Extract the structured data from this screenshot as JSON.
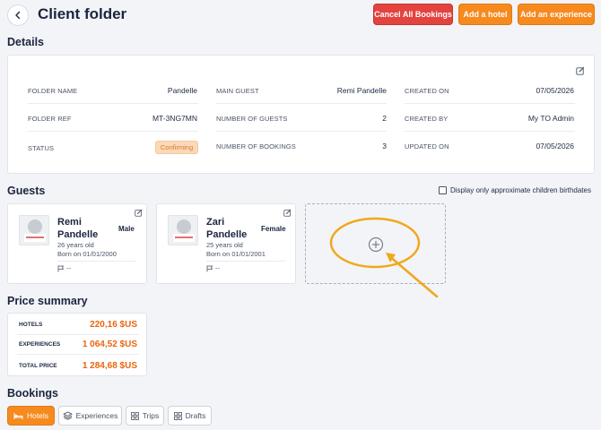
{
  "header": {
    "title": "Client folder",
    "cancel_all_bookings": "Cancel All Bookings",
    "add_hotel": "Add a hotel",
    "add_experience": "Add an experience"
  },
  "details": {
    "heading": "Details",
    "folder_name_label": "FOLDER NAME",
    "folder_name": "Pandelle",
    "folder_ref_label": "FOLDER REF",
    "folder_ref": "MT-3NG7MN",
    "status_label": "STATUS",
    "status": "Confirming",
    "main_guest_label": "MAIN GUEST",
    "main_guest": "Remi Pandelle",
    "number_of_guests_label": "NUMBER OF GUESTS",
    "number_of_guests": "2",
    "number_of_bookings_label": "NUMBER OF BOOKINGS",
    "number_of_bookings": "3",
    "created_on_label": "CREATED ON",
    "created_on": "07/05/2026",
    "created_by_label": "CREATED BY",
    "created_by": "My TO Admin",
    "updated_on_label": "UPDATED ON",
    "updated_on": "07/05/2026"
  },
  "guests": {
    "heading": "Guests",
    "approx_birthdates_label": "Display only approximate children birthdates",
    "approx_birthdates_checked": false,
    "list": [
      {
        "first": "Remi",
        "last": "Pandelle",
        "gender": "Male",
        "age": "26 years old",
        "born": "Born on 01/01/2000",
        "nationality": "--"
      },
      {
        "first": "Zari",
        "last": "Pandelle",
        "gender": "Female",
        "age": "25 years old",
        "born": "Born on 01/01/2001",
        "nationality": "--"
      }
    ]
  },
  "price_summary": {
    "heading": "Price summary",
    "hotels_label": "HOTELS",
    "hotels": "220,16 $US",
    "experiences_label": "EXPERIENCES",
    "experiences": "1 064,52 $US",
    "total_label": "TOTAL PRICE",
    "total": "1 284,68 $US"
  },
  "bookings": {
    "heading": "Bookings",
    "tabs": [
      {
        "label": "Hotels",
        "active": true
      },
      {
        "label": "Experiences",
        "active": false
      },
      {
        "label": "Trips",
        "active": false
      },
      {
        "label": "Drafts",
        "active": false
      }
    ]
  },
  "colors": {
    "accent_orange": "#f68a1f",
    "danger_red": "#e3433f",
    "price_orange": "#e8660f",
    "annotation": "#f0a81c"
  }
}
